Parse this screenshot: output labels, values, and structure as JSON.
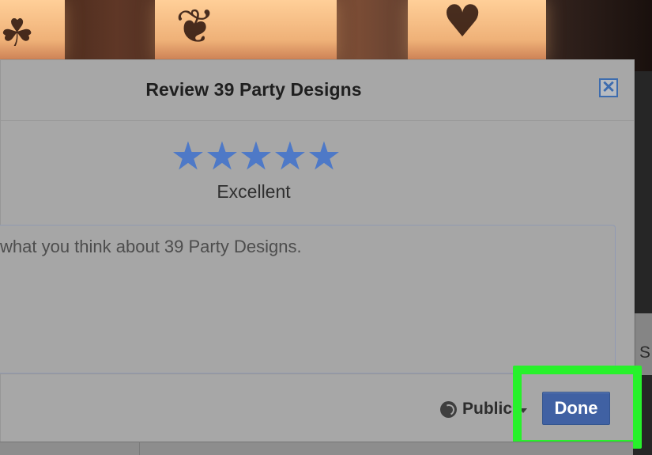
{
  "dialog": {
    "title": "Review 39 Party Designs",
    "rating_text": "Excellent",
    "rating": 5,
    "review_placeholder": "what you think about 39 Party Designs.",
    "privacy_label": "Public",
    "done_label": "Done",
    "close_label": "✕"
  },
  "background": {
    "visible_cut_text": "S"
  },
  "icons": {
    "close": "close-icon",
    "star": "star-icon",
    "globe": "globe-icon",
    "dropdown": "chevron-down-icon"
  },
  "colors": {
    "accent": "#4e79c7",
    "done_button": "#4061a3",
    "highlight": "#27f12b",
    "dialog_bg": "#a7a7a7",
    "close_border": "#3d6cae"
  }
}
